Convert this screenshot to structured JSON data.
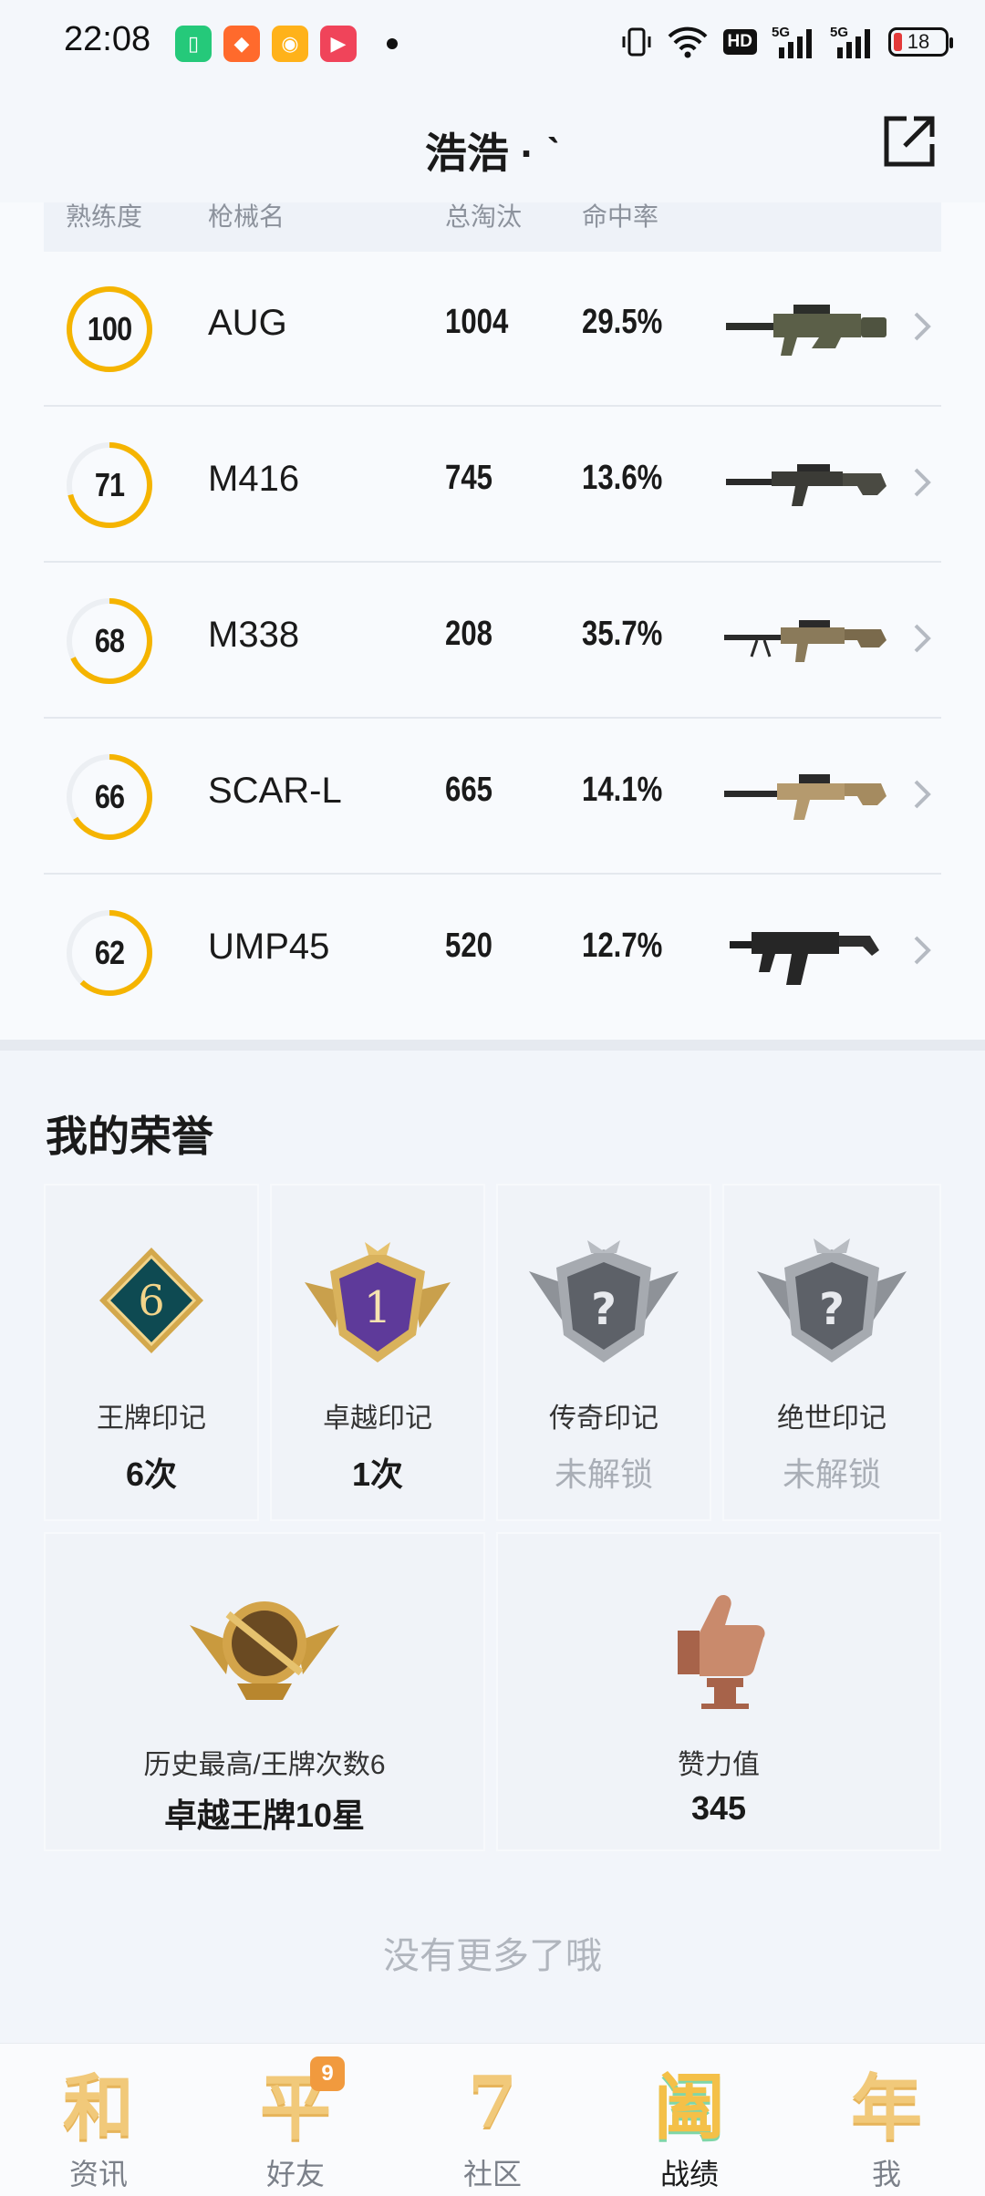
{
  "status_bar": {
    "time": "22:08",
    "battery": "18",
    "hd_label": "HD",
    "net_label_1": "5G",
    "net_label_2": "5G"
  },
  "header": {
    "title": "浩浩 · ˋ"
  },
  "weapon_table": {
    "columns": [
      "熟练度",
      "枪械名",
      "总淘汰",
      "命中率"
    ],
    "rows": [
      {
        "mastery": "100",
        "mastery_pct": 1.0,
        "name": "AUG",
        "kills": "1004",
        "hit_rate": "29.5%"
      },
      {
        "mastery": "71",
        "mastery_pct": 0.71,
        "name": "M416",
        "kills": "745",
        "hit_rate": "13.6%"
      },
      {
        "mastery": "68",
        "mastery_pct": 0.68,
        "name": "M338",
        "kills": "208",
        "hit_rate": "35.7%"
      },
      {
        "mastery": "66",
        "mastery_pct": 0.66,
        "name": "SCAR-L",
        "kills": "665",
        "hit_rate": "14.1%"
      },
      {
        "mastery": "62",
        "mastery_pct": 0.62,
        "name": "UMP45",
        "kills": "520",
        "hit_rate": "12.7%"
      }
    ]
  },
  "honors": {
    "title": "我的荣誉",
    "marks": [
      {
        "label": "王牌印记",
        "value": "6次",
        "badge_num": "6"
      },
      {
        "label": "卓越印记",
        "value": "1次",
        "badge_num": "1"
      },
      {
        "label": "传奇印记",
        "value": "未解锁",
        "badge_num": "?"
      },
      {
        "label": "绝世印记",
        "value": "未解锁",
        "badge_num": "?"
      }
    ],
    "best": {
      "label": "历史最高/王牌次数6",
      "value": "卓越王牌10星"
    },
    "likes": {
      "label": "赞力值",
      "value": "345"
    }
  },
  "footer_text": "没有更多了哦",
  "bottom_nav": {
    "items": [
      {
        "label": "资讯",
        "glyph": "和"
      },
      {
        "label": "好友",
        "glyph": "平",
        "badge": "9"
      },
      {
        "label": "社区",
        "glyph": "7"
      },
      {
        "label": "战绩",
        "glyph": "阖"
      },
      {
        "label": "我",
        "glyph": "年"
      }
    ]
  },
  "colors": {
    "accent": "#f5b400",
    "ring_track": "#eceff3",
    "locked": "#a9aeb6"
  }
}
